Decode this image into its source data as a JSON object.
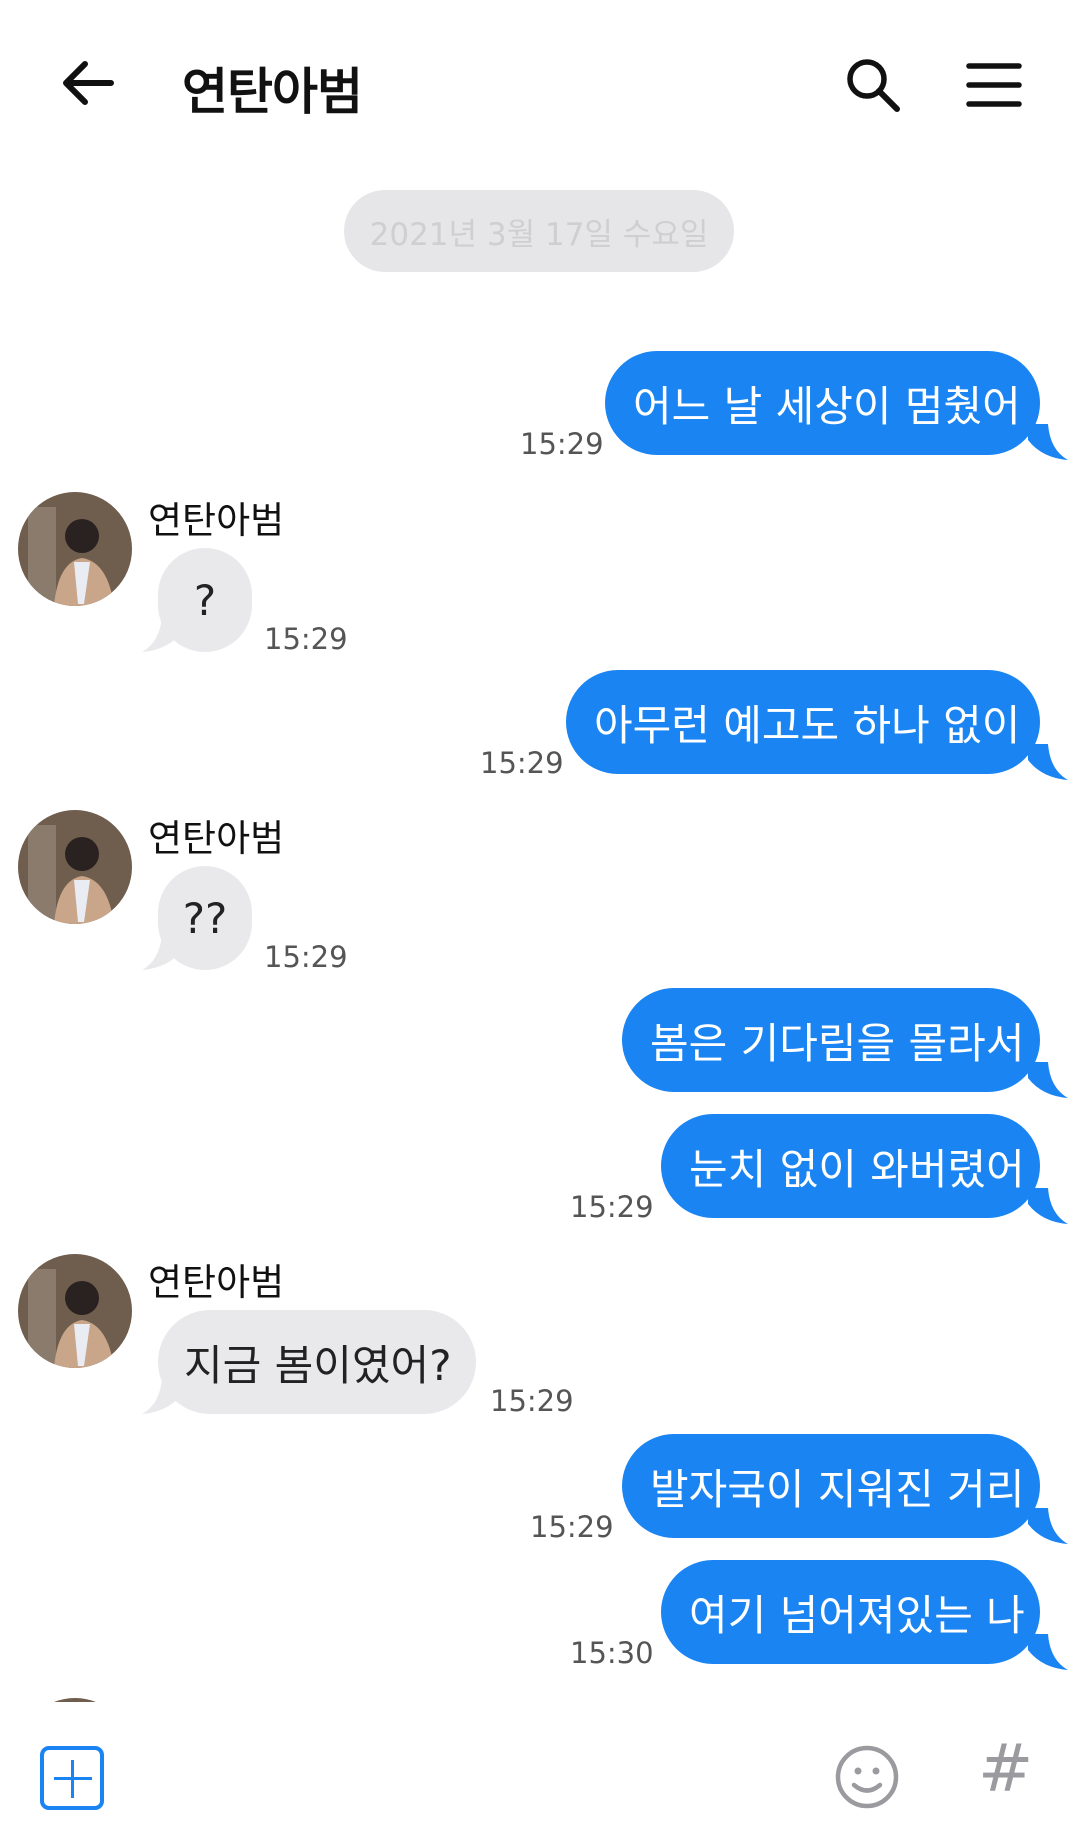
{
  "header": {
    "title": "연탄아범",
    "back_icon": "arrow-left-icon",
    "search_icon": "search-icon",
    "menu_icon": "hamburger-menu-icon"
  },
  "date_divider": "2021년 3월 17일 수요일",
  "colors": {
    "outgoing_bubble": "#1a84f2",
    "incoming_bubble": "#e9e9ec",
    "accent": "#1a84f2"
  },
  "messages": [
    {
      "dir": "out",
      "text": "어느 날 세상이 멈췄어",
      "time": "15:29"
    },
    {
      "dir": "in",
      "sender": "연탄아범",
      "text": "?",
      "time": "15:29"
    },
    {
      "dir": "out",
      "text": "아무런 예고도 하나 없이",
      "time": "15:29"
    },
    {
      "dir": "in",
      "sender": "연탄아범",
      "text": "??",
      "time": "15:29"
    },
    {
      "dir": "out",
      "text": "봄은 기다림을 몰라서",
      "time": ""
    },
    {
      "dir": "out",
      "text": "눈치 없이 와버렸어",
      "time": "15:29"
    },
    {
      "dir": "in",
      "sender": "연탄아범",
      "text": "지금 봄이였어?",
      "time": "15:29"
    },
    {
      "dir": "out",
      "text": "발자국이 지워진 거리",
      "time": "15:29"
    },
    {
      "dir": "out",
      "text": "여기 넘어져있는 나",
      "time": "15:30"
    },
    {
      "dir": "in",
      "sender": "연탄아범",
      "text": "",
      "time": ""
    }
  ],
  "bottom_bar": {
    "plus_icon": "plus-square-icon",
    "emoji_icon": "smiley-icon",
    "hash_label": "#"
  }
}
